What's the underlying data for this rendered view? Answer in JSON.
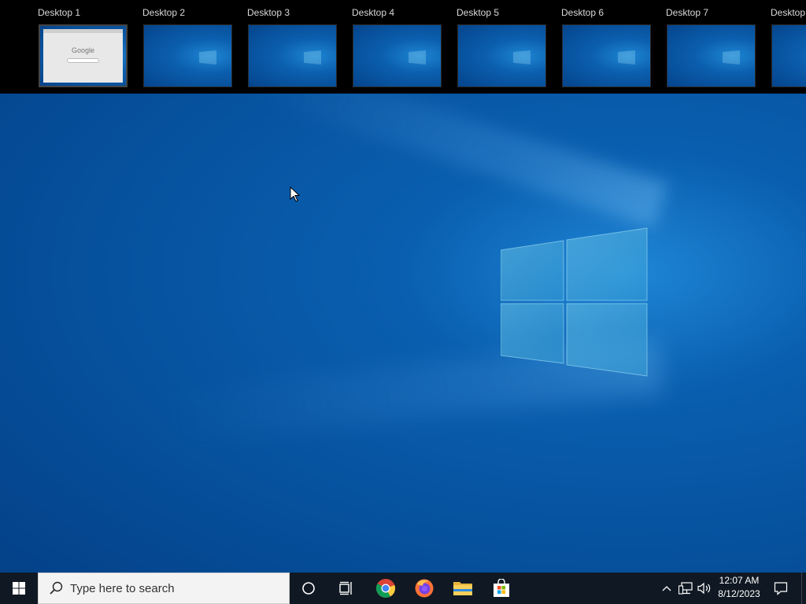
{
  "task_view": {
    "desktops": [
      {
        "label": "Desktop 1",
        "active": true
      },
      {
        "label": "Desktop 2",
        "active": false
      },
      {
        "label": "Desktop 3",
        "active": false
      },
      {
        "label": "Desktop 4",
        "active": false
      },
      {
        "label": "Desktop 5",
        "active": false
      },
      {
        "label": "Desktop 6",
        "active": false
      },
      {
        "label": "Desktop 7",
        "active": false
      },
      {
        "label": "Desktop",
        "active": false
      }
    ],
    "thumbnail_brand": "Google"
  },
  "taskbar": {
    "search_placeholder": "Type here to search",
    "pinned": [
      "chrome-icon",
      "firefox-icon",
      "file-explorer-icon",
      "microsoft-store-icon"
    ],
    "clock_time": "12:07 AM",
    "clock_date": "8/12/2023"
  },
  "colors": {
    "taskbar_bg": "#101923",
    "desktop_blue": "#0653a0",
    "taskview_bg": "#000000"
  }
}
